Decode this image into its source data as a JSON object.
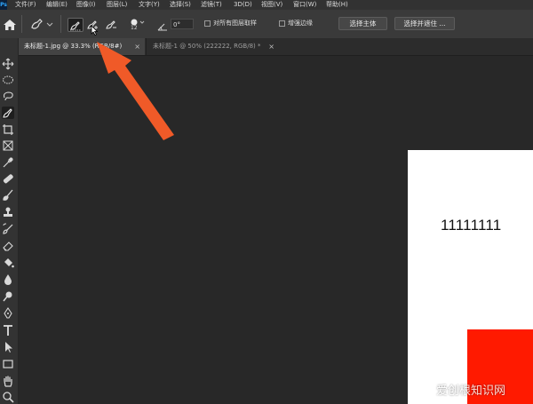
{
  "menubar": {
    "logo": "Ps",
    "items": [
      "文件(F)",
      "编辑(E)",
      "图像(I)",
      "图层(L)",
      "文字(Y)",
      "选择(S)",
      "滤镜(T)",
      "3D(D)",
      "视图(V)",
      "窗口(W)",
      "帮助(H)"
    ]
  },
  "options": {
    "brush_size": "12",
    "angle_value": "0°",
    "sample_all_layers_label": "对所有图层取样",
    "enhance_edge_label": "增强边缘",
    "select_subject_label": "选择主体",
    "select_and_mask_label": "选择并遮住 ..."
  },
  "tabs": [
    {
      "label": "未标题-1.jpg @ 33.3% (RGB/8#)",
      "close": "×"
    },
    {
      "label": "未标题-1 @ 50% (222222, RGB/8) *",
      "close": "×"
    }
  ],
  "document": {
    "text": "11111111"
  },
  "watermark": "爱创根知识网",
  "colors": {
    "accent_arrow": "#f05a28",
    "red_shape": "#ff1a00",
    "canvas_bg": "#282828"
  },
  "tools": [
    "move-icon",
    "marquee-icon",
    "lasso-icon",
    "quick-selection-icon",
    "crop-icon",
    "frame-icon",
    "eyedropper-icon",
    "healing-icon",
    "brush-icon",
    "stamp-icon",
    "history-brush-icon",
    "eraser-icon",
    "paint-bucket-icon",
    "blur-icon",
    "dodge-icon",
    "pen-icon",
    "type-icon",
    "path-selection-icon",
    "rectangle-icon",
    "hand-icon",
    "zoom-icon"
  ]
}
